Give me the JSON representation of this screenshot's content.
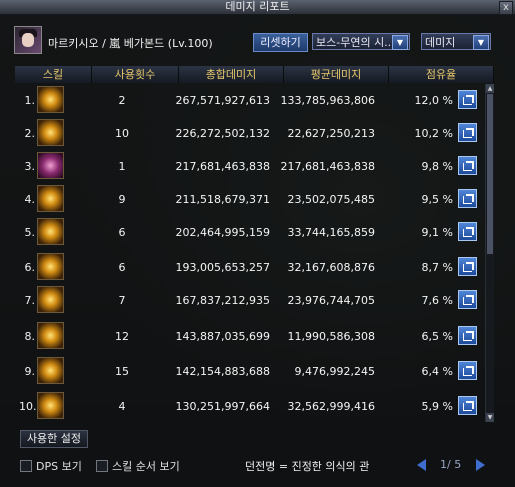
{
  "window": {
    "title": "데미지 리포트",
    "close_label": "x"
  },
  "header": {
    "character": "마르키시오 / 嵐 베가본드 (Lv.100)",
    "reset_label": "리셋하기",
    "dungeon_select": "보스-무연의 시..",
    "metric_select": "데미지"
  },
  "table": {
    "columns": [
      "스킬",
      "사용횟수",
      "총합데미지",
      "평균데미지",
      "점유율"
    ],
    "rows": [
      {
        "rank": "1.",
        "uses": "2",
        "total": "267,571,927,613",
        "avg": "133,785,963,806",
        "share": "12,0 %",
        "icon": "skill-swirl-icon"
      },
      {
        "rank": "2.",
        "uses": "10",
        "total": "226,272,502,132",
        "avg": "22,627,250,213",
        "share": "10,2 %",
        "icon": "skill-slash-icon"
      },
      {
        "rank": "3.",
        "uses": "1",
        "total": "217,681,463,838",
        "avg": "217,681,463,838",
        "share": "9,8 %",
        "icon": "skill-burst-icon"
      },
      {
        "rank": "4.",
        "uses": "9",
        "total": "211,518,679,371",
        "avg": "23,502,075,485",
        "share": "9,5 %",
        "icon": "skill-cross-icon"
      },
      {
        "rank": "5.",
        "uses": "6",
        "total": "202,464,995,159",
        "avg": "33,744,165,859",
        "share": "9,1 %",
        "icon": "skill-strike-icon"
      },
      {
        "rank": "6.",
        "uses": "6",
        "total": "193,005,653,257",
        "avg": "32,167,608,876",
        "share": "8,7 %",
        "icon": "skill-dash-icon"
      },
      {
        "rank": "7.",
        "uses": "7",
        "total": "167,837,212,935",
        "avg": "23,976,744,705",
        "share": "7,6 %",
        "icon": "skill-wave-icon"
      },
      {
        "rank": "8.",
        "uses": "12",
        "total": "143,887,035,699",
        "avg": "11,990,586,308",
        "share": "6,5 %",
        "icon": "skill-star-icon"
      },
      {
        "rank": "9.",
        "uses": "15",
        "total": "142,154,883,688",
        "avg": "9,476,992,245",
        "share": "6,4 %",
        "icon": "skill-fire-icon"
      },
      {
        "rank": "10.",
        "uses": "4",
        "total": "130,251,997,664",
        "avg": "32,562,999,416",
        "share": "5,9 %",
        "icon": "skill-blade-icon"
      }
    ]
  },
  "settings_tab": "사용한 설정",
  "footer": {
    "dps_label": "DPS 보기",
    "order_label": "스킬 순서 보기",
    "dungeon_name": "던전명 = 진정한 의식의 관",
    "page": "1/ 5"
  },
  "colors": {
    "header_text": "#e8c86a",
    "accent_blue": "#3f6ed0"
  }
}
